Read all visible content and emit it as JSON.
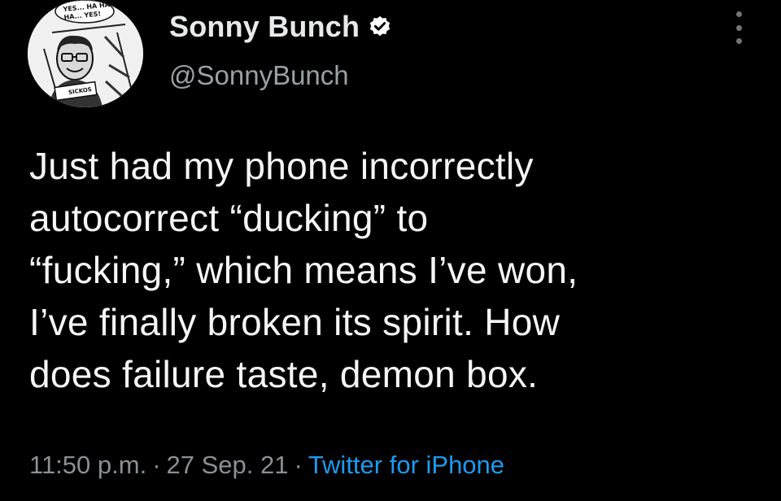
{
  "header": {
    "avatar": {
      "bubble_text": "YES... HA HA HA... YES!",
      "sign_text": "SICKOS"
    },
    "display_name": "Sonny Bunch",
    "handle": "@SonnyBunch",
    "verified_icon": "verified-badge-icon",
    "more_icon": "vertical-ellipsis-icon"
  },
  "tweet": {
    "text_lines": [
      "Just had my phone incorrectly",
      "autocorrect “ducking” to",
      "“fucking,” which means I’ve won,",
      "I’ve finally broken its spirit. How",
      "does failure taste, demon box."
    ]
  },
  "meta": {
    "time": "11:50 p.m.",
    "date": "27 Sep. 21",
    "separator": "·",
    "source": "Twitter for iPhone"
  },
  "colors": {
    "background": "#000000",
    "text": "#e7e9ea",
    "muted": "#8b9096",
    "accent": "#1d9bf0"
  }
}
